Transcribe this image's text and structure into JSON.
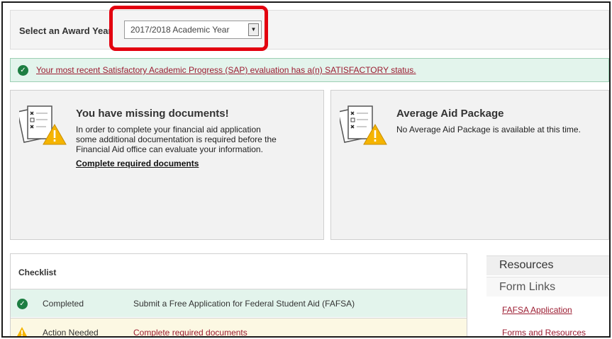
{
  "award_year": {
    "label": "Select an Award Year",
    "selected": "2017/2018 Academic Year"
  },
  "sap_banner": {
    "text": "Your most recent Satisfactory Academic Progress (SAP) evaluation has a(n) SATISFACTORY status."
  },
  "missing_docs_card": {
    "title": "You have missing documents!",
    "line1": "In order to complete your financial aid application",
    "line2": "some additional documentation is required before the",
    "line3": "Financial Aid office can evaluate your information.",
    "link": "Complete required documents"
  },
  "aid_package_card": {
    "title": "Average Aid Package",
    "text": "No Average Aid Package is available at this time."
  },
  "checklist": {
    "title": "Checklist",
    "rows": [
      {
        "status": "Completed",
        "description": "Submit a Free Application for Federal Student Aid (FAFSA)"
      },
      {
        "status": "Action Needed",
        "description": "Complete required documents"
      }
    ]
  },
  "resources": {
    "heading": "Resources",
    "subheading": "Form Links",
    "links": [
      "FAFSA Application",
      "Forms and Resources"
    ]
  },
  "colors": {
    "highlight": "#e3000f",
    "success_bg": "#e3f4ec",
    "warning_bg": "#fcf8e3",
    "link": "#9b1b30",
    "success_icon": "#1d7e42",
    "warning_icon": "#f5b400"
  }
}
